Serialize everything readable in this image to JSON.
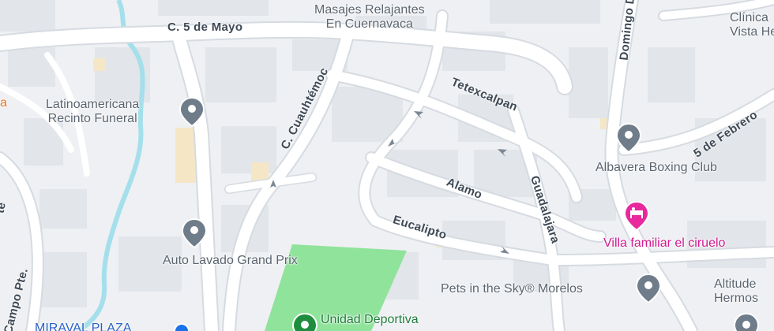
{
  "colors": {
    "background": "#eef0f3",
    "road": "#ffffff",
    "road_edge": "#d3d8de",
    "river": "#9fdcea",
    "park": "#8fe39a",
    "block": "#e1e4e8",
    "poi_pin": "#6f7c8a",
    "hotel_pin": "#e8289c",
    "park_pin": "#1e8e3e",
    "transit_pin": "#1a73e8",
    "arrow": "#7c8894"
  },
  "streets": {
    "cinco_de_mayo": "C. 5 de Mayo",
    "cuauhtemoc": "C. Cuauhtémoc",
    "tetexcalpan": "Tetexcalpan",
    "alamo": "Alamo",
    "eucalipto": "Eucalipto",
    "guadalajara": "Guadalajara",
    "domingo_diez": "Domingo Diez",
    "cinco_de_febrero": "5 de Febrero",
    "campo_pte": "Campo Pte.",
    "edge_left_top": "te"
  },
  "places": {
    "masajes": {
      "line1": "Masajes Relajantes",
      "line2": "En Cuernavaca",
      "icon": "spa-pin-icon"
    },
    "latino": {
      "line1": "Latinoamericana",
      "line2": "Recinto Funeral",
      "icon": "place-pin-icon"
    },
    "autolavado": {
      "line1": "Auto Lavado Grand Prix",
      "icon": "place-pin-icon"
    },
    "albavera": {
      "line1": "Albavera Boxing Club",
      "icon": "place-pin-icon"
    },
    "villa": {
      "line1": "Villa familiar el ciruelo",
      "icon": "hotel-bed-icon"
    },
    "pets": {
      "line1": "Pets in the Sky® Morelos",
      "icon": "place-pin-icon"
    },
    "unidad": {
      "line1": "Unidad Deportiva",
      "icon": "park-pin-icon"
    },
    "clinica": {
      "line1": "Clínica",
      "line2": "Vista Herm",
      "icon": "place-pin-icon"
    },
    "altitude": {
      "line1": "Altitude",
      "line2": "Hermos",
      "icon": "place-pin-icon"
    },
    "miraval": {
      "line1": "MIRAVAL PLAZA",
      "icon": "shopping-pin-icon"
    },
    "edge_orange": {
      "line1": "a"
    }
  }
}
